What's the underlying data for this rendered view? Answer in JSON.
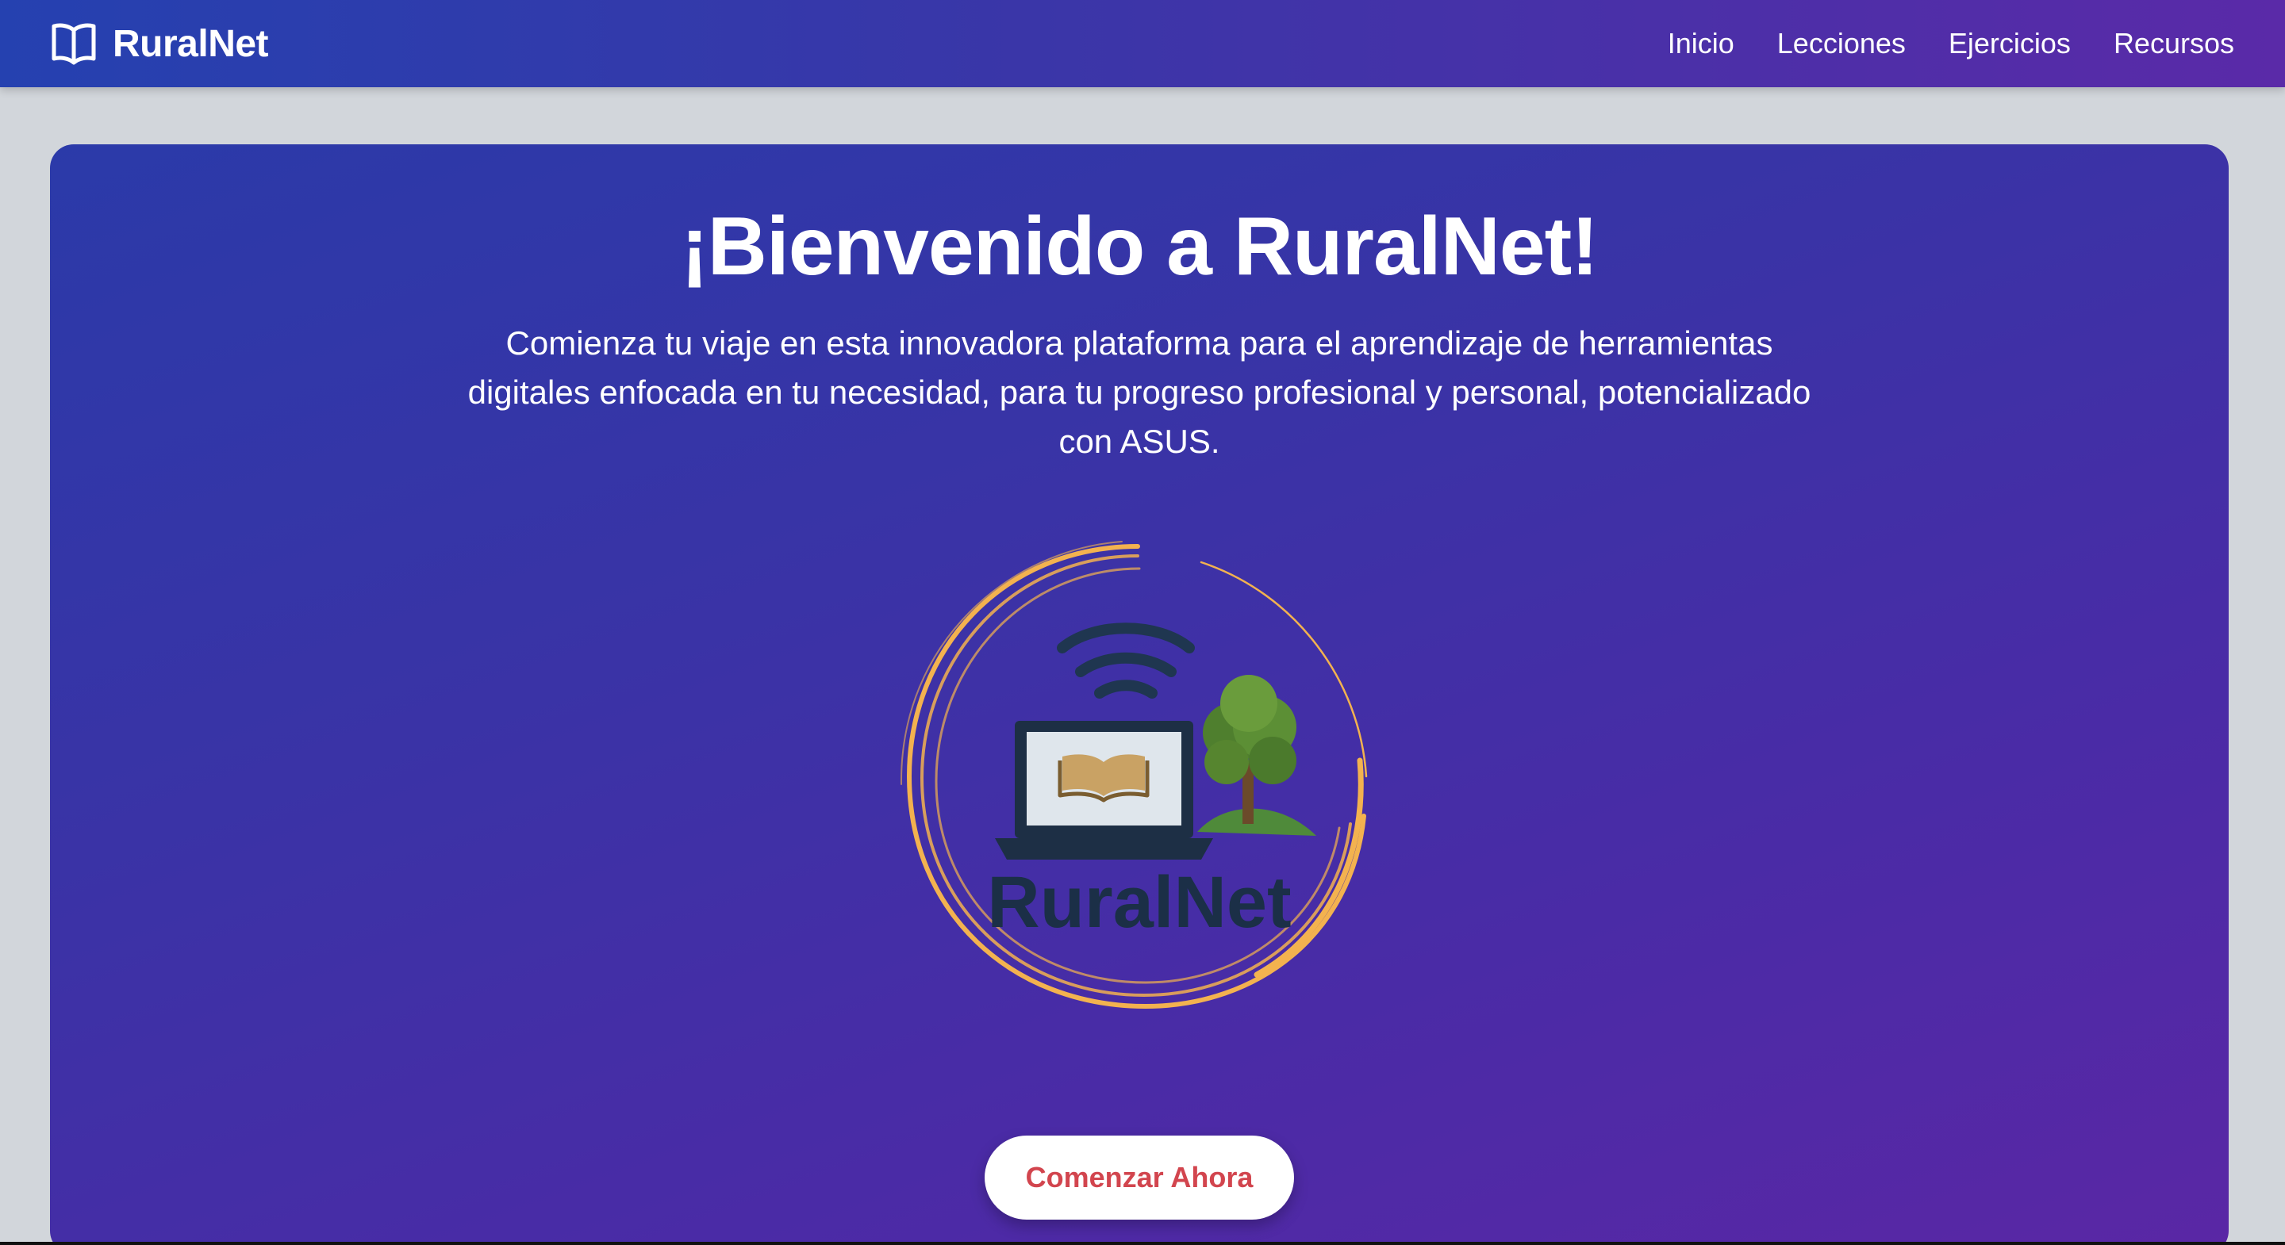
{
  "header": {
    "brand_name": "RuralNet",
    "brand_icon": "open-book-icon",
    "nav": [
      {
        "label": "Inicio"
      },
      {
        "label": "Lecciones"
      },
      {
        "label": "Ejercicios"
      },
      {
        "label": "Recursos"
      }
    ]
  },
  "hero": {
    "title": "¡Bienvenido a RuralNet!",
    "subtitle": "Comienza tu viaje en esta innovadora plataforma para el aprendizaje de herramientas digitales enfocada en tu necesidad, para tu progreso profesional y personal, potencializado con ASUS.",
    "logo_text": "RuralNet",
    "cta_label": "Comenzar Ahora"
  },
  "colors": {
    "header_gradient_start": "#2541b0",
    "header_gradient_end": "#5a2aa8",
    "page_background": "#d2d6db",
    "cta_text": "#d2454e",
    "logo_ring": "#f3b24f"
  }
}
